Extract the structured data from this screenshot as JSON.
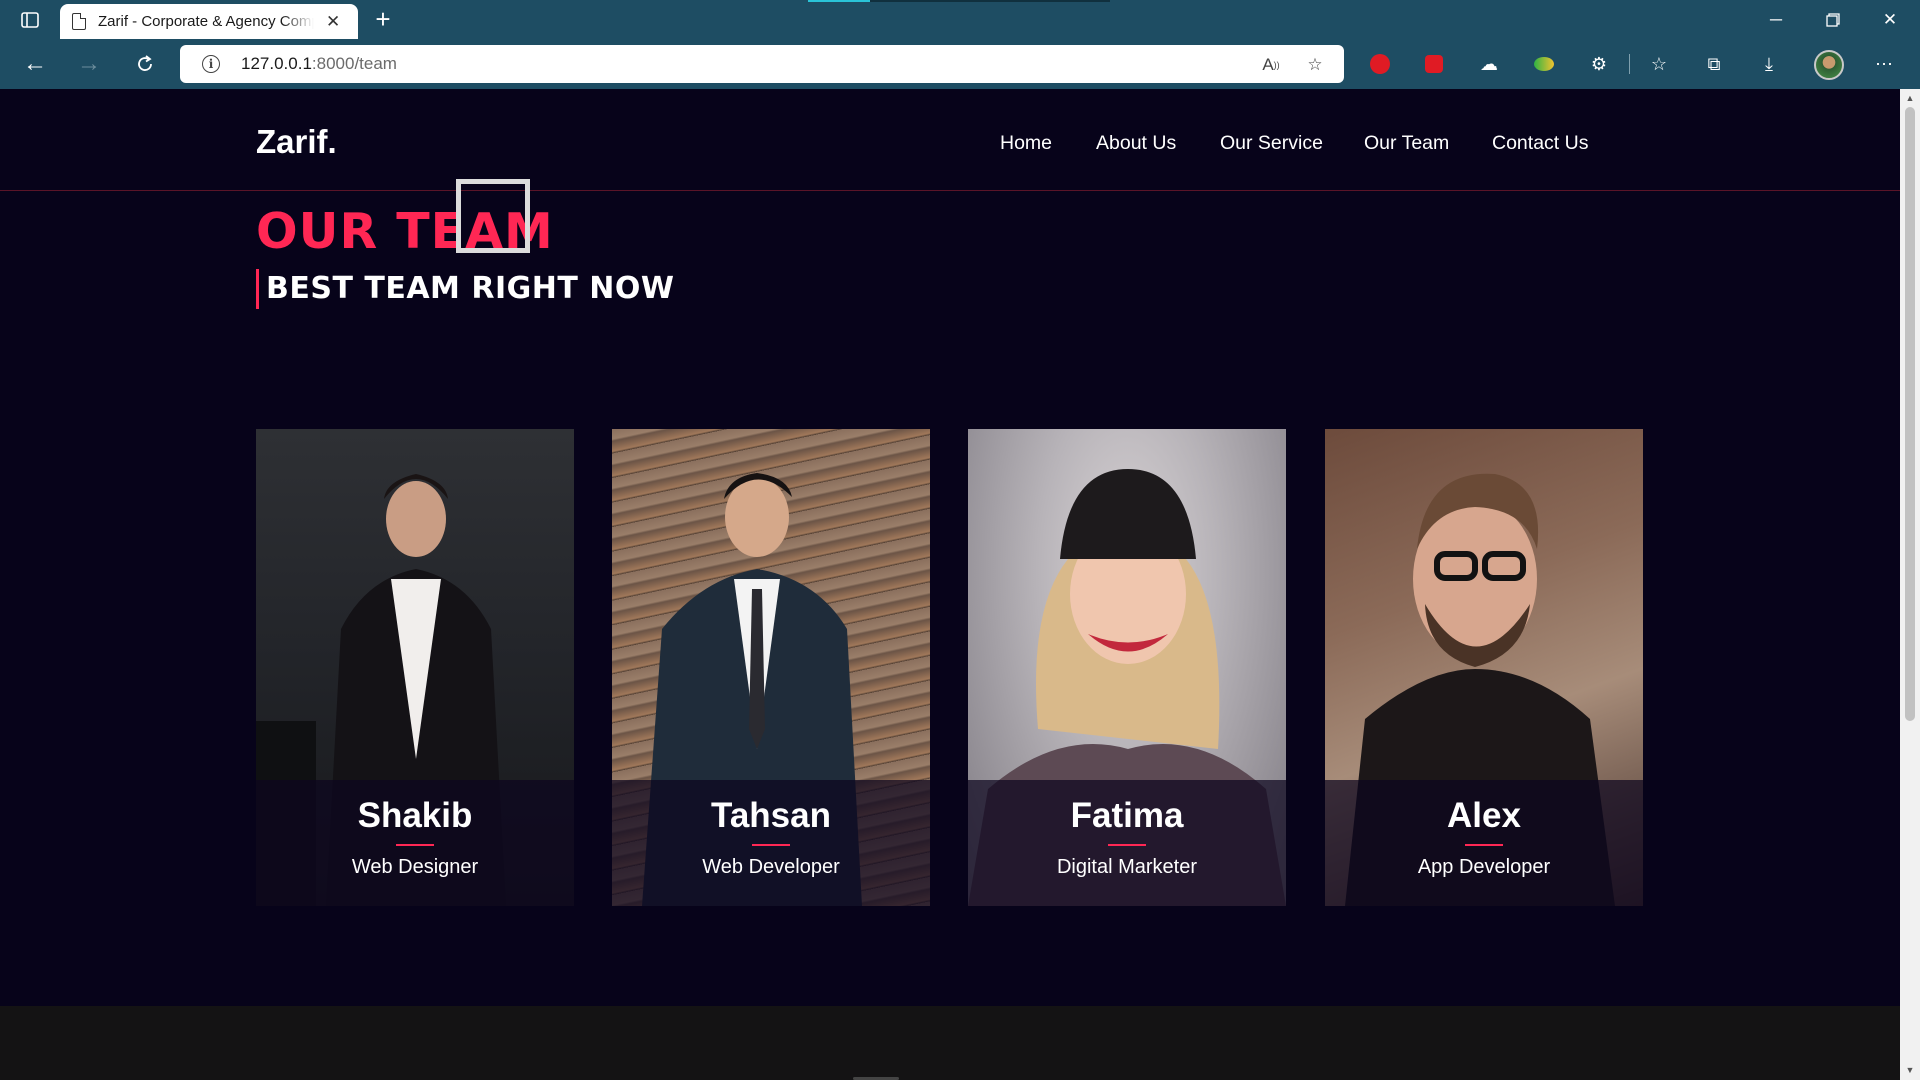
{
  "browser": {
    "tab_title": "Zarif - Corporate & Agency Company",
    "url_host": "127.0.0.1",
    "url_port": ":8000",
    "url_path": "/team"
  },
  "site": {
    "logo": "Zarif.",
    "nav": [
      "Home",
      "About Us",
      "Our Service",
      "Our Team",
      "Contact Us"
    ],
    "section_title": "OUR TEAM",
    "section_subtitle": "BEST TEAM RIGHT NOW"
  },
  "team": [
    {
      "name": "Shakib",
      "role": "Web Designer"
    },
    {
      "name": "Tahsan",
      "role": "Web Developer"
    },
    {
      "name": "Fatima",
      "role": "Digital Marketer"
    },
    {
      "name": "Alex",
      "role": "App Developer"
    }
  ],
  "colors": {
    "accent": "#ff2754",
    "page_bg": "#07031a",
    "browser_chrome": "#1e4d63"
  }
}
